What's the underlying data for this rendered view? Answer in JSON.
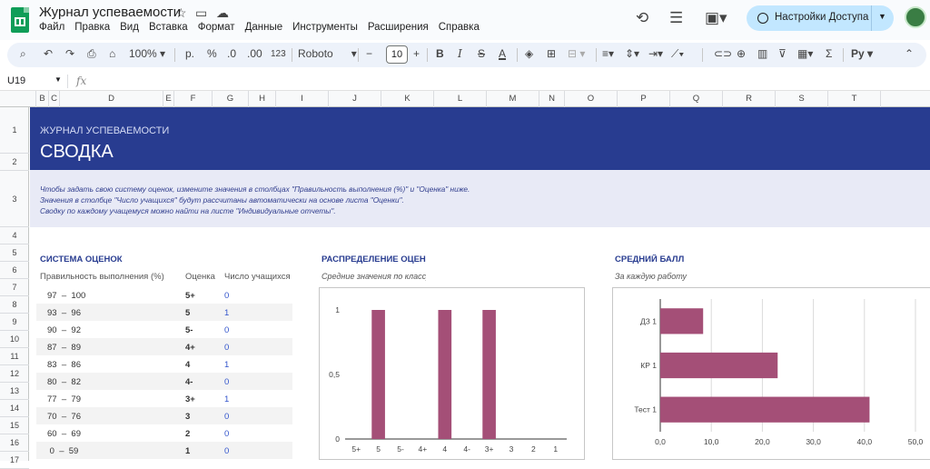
{
  "app": {
    "doc_title": "Журнал успеваемости",
    "menu": [
      "Файл",
      "Правка",
      "Вид",
      "Вставка",
      "Формат",
      "Данные",
      "Инструменты",
      "Расширения",
      "Справка"
    ],
    "share_label": "Настройки Доступа"
  },
  "toolbar": {
    "zoom": "100%",
    "currency": "р.",
    "percent": "%",
    "dec_decrease": ".0",
    "dec_increase": ".00",
    "number_format": "123",
    "font": "Roboto",
    "font_size": "10"
  },
  "formula_bar": {
    "cell_ref": "U19",
    "fx": "fx"
  },
  "columns": [
    "B",
    "C",
    "D",
    "E",
    "F",
    "G",
    "H",
    "I",
    "J",
    "K",
    "L",
    "M",
    "N",
    "O",
    "P",
    "Q",
    "R",
    "S",
    "T"
  ],
  "rows": [
    "1",
    "2",
    "3",
    "4",
    "5",
    "6",
    "7",
    "8",
    "9",
    "10",
    "11",
    "12",
    "13",
    "14",
    "15",
    "16",
    "17"
  ],
  "banner": {
    "subtitle": "ЖУРНАЛ УСПЕВАЕМОСТИ",
    "title": "СВОДКА"
  },
  "info": [
    "Чтобы задать свою систему оценок, измените значения в столбцах \"Правильность выполнения (%)\" и \"Оценка\" ниже.",
    "Значения в столбце \"Число учащихся\" будут рассчитаны автоматически на основе листа \"Оценки\".",
    "Сводку по каждому учащемуся можно найти на листе \"Индивидуальные отчеты\"."
  ],
  "grading": {
    "title": "СИСТЕМА ОЦЕНОК",
    "headers": [
      "Правильность выполнения (%)",
      "Оценка",
      "Число учащихся"
    ],
    "rows": [
      {
        "range": "97  –  100",
        "grade": "5+",
        "count": "0"
      },
      {
        "range": "93  –  96",
        "grade": "5",
        "count": "1"
      },
      {
        "range": "90  –  92",
        "grade": "5-",
        "count": "0"
      },
      {
        "range": "87  –  89",
        "grade": "4+",
        "count": "0"
      },
      {
        "range": "83  –  86",
        "grade": "4",
        "count": "1"
      },
      {
        "range": "80  –  82",
        "grade": "4-",
        "count": "0"
      },
      {
        "range": "77  –  79",
        "grade": "3+",
        "count": "1"
      },
      {
        "range": "70  –  76",
        "grade": "3",
        "count": "0"
      },
      {
        "range": "60  –  69",
        "grade": "2",
        "count": "0"
      },
      {
        "range": " 0  –  59",
        "grade": "1",
        "count": "0"
      }
    ]
  },
  "distribution": {
    "title": "РАСПРЕДЕЛЕНИЕ ОЦЕНОК",
    "subtitle": "Средние значения по классу"
  },
  "average": {
    "title": "СРЕДНИЙ БАЛЛ",
    "subtitle": "За каждую работу"
  },
  "colors": {
    "accent": "#283c90",
    "bar": "#a44f77"
  },
  "chart_data": [
    {
      "type": "bar",
      "categories": [
        "5+",
        "5",
        "5-",
        "4+",
        "4",
        "4-",
        "3+",
        "3",
        "2",
        "1"
      ],
      "values": [
        0,
        1,
        0,
        0,
        1,
        0,
        1,
        0,
        0,
        0
      ],
      "ylim": [
        0,
        1
      ],
      "yticks": [
        "0",
        "0,5",
        "1"
      ],
      "grid": false
    },
    {
      "type": "bar",
      "orientation": "horizontal",
      "categories": [
        "ДЗ 1",
        "КР 1",
        "Тест 1"
      ],
      "values": [
        8.4,
        23,
        41
      ],
      "xlim": [
        0,
        50
      ],
      "xticks": [
        "0,0",
        "10,0",
        "20,0",
        "30,0",
        "40,0",
        "50,0"
      ],
      "grid": true
    }
  ]
}
